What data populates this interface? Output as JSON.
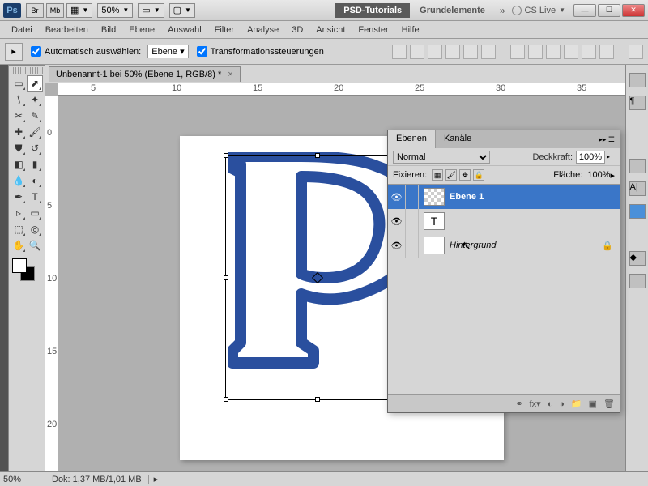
{
  "titlebar": {
    "app": "Ps",
    "br": "Br",
    "mb": "Mb",
    "zoom": "50%",
    "tab_dark": "PSD-Tutorials",
    "tab_light": "Grundelemente",
    "cs_live": "CS Live"
  },
  "menu": [
    "Datei",
    "Bearbeiten",
    "Bild",
    "Ebene",
    "Auswahl",
    "Filter",
    "Analyse",
    "3D",
    "Ansicht",
    "Fenster",
    "Hilfe"
  ],
  "options": {
    "auto_label": "Automatisch auswählen:",
    "auto_dd": "Ebene",
    "trans_label": "Transformationssteuerungen"
  },
  "doc_tab": "Unbenannt-1 bei 50% (Ebene 1, RGB/8) *",
  "ruler_h": [
    "5",
    "10",
    "15",
    "20",
    "25",
    "30",
    "35"
  ],
  "ruler_v": [
    "0",
    "5",
    "10",
    "15",
    "20"
  ],
  "panel": {
    "tab1": "Ebenen",
    "tab2": "Kanäle",
    "mode": "Normal",
    "opacity_lbl": "Deckkraft:",
    "opacity": "100%",
    "lock_lbl": "Fixieren:",
    "fill_lbl": "Fläche:",
    "fill": "100%",
    "layers": [
      {
        "name": "Ebene 1",
        "sel": true,
        "thumb": "checker"
      },
      {
        "name": "",
        "sel": false,
        "thumb": "T"
      },
      {
        "name": "Hintergrund",
        "sel": false,
        "thumb": "white",
        "italic": true,
        "locked": true
      }
    ]
  },
  "status": {
    "zoom": "50%",
    "doc": "Dok: 1,37 MB/1,01 MB"
  }
}
